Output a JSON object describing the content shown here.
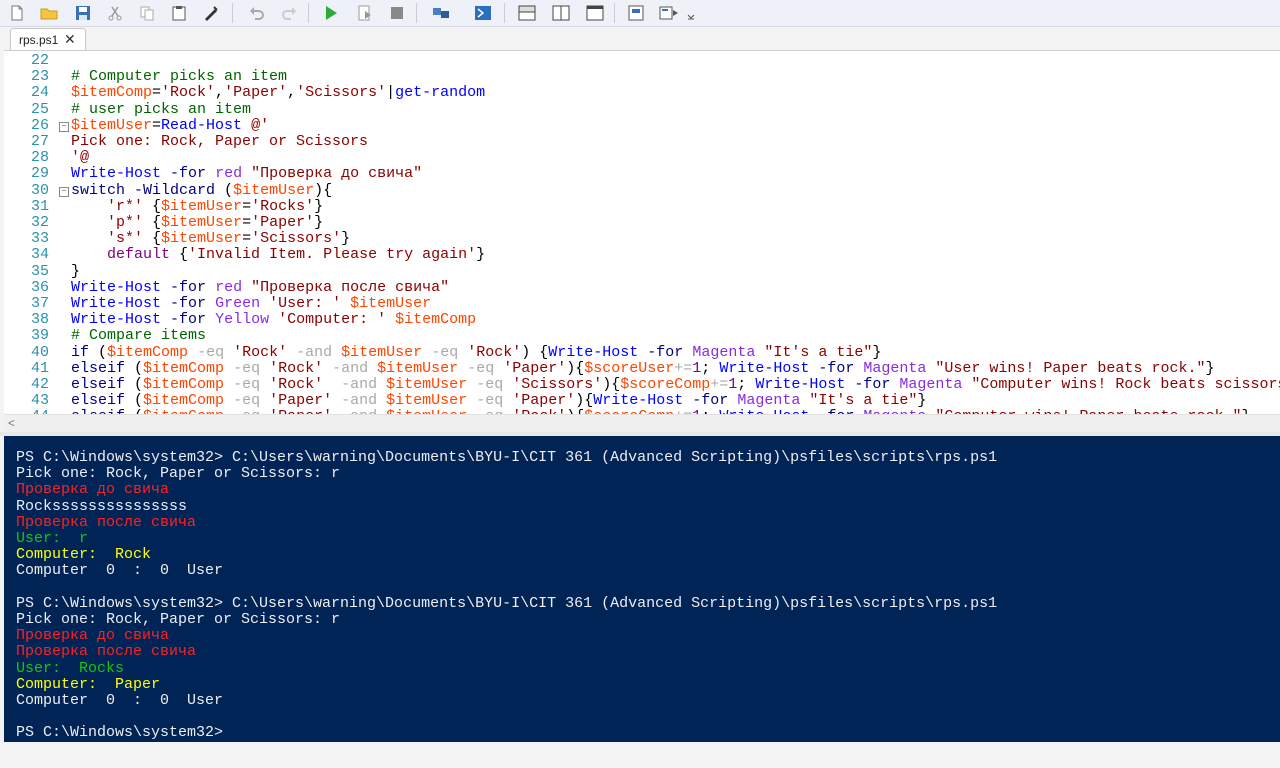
{
  "toolbar": {
    "icons": [
      "new-file-icon",
      "open-folder-icon",
      "save-icon",
      "cut-icon",
      "copy-icon",
      "paste-icon",
      "clear-icon",
      "undo-icon",
      "redo-icon",
      "run-icon",
      "run-selection-icon",
      "stop-icon",
      "remote-icon",
      "powershell-icon",
      "layout-top-icon",
      "layout-right-icon",
      "layout-max-icon",
      "show-script-pane-icon",
      "show-commands-icon",
      "overflow-icon"
    ]
  },
  "tab": {
    "label": "rps.ps1",
    "close": "✕"
  },
  "editor": {
    "lines": [
      {
        "n": "22",
        "fold": false,
        "tokens": []
      },
      {
        "n": "23",
        "fold": false,
        "tokens": [
          [
            "t-comment",
            "# Computer picks an item"
          ]
        ]
      },
      {
        "n": "24",
        "fold": false,
        "tokens": [
          [
            "t-var",
            "$itemComp"
          ],
          [
            "t-plain",
            "="
          ],
          [
            "t-str",
            "'Rock'"
          ],
          [
            "t-plain",
            ","
          ],
          [
            "t-str",
            "'Paper'"
          ],
          [
            "t-plain",
            ","
          ],
          [
            "t-str",
            "'Scissors'"
          ],
          [
            "t-plain",
            "|"
          ],
          [
            "t-cmd",
            "get-random"
          ]
        ]
      },
      {
        "n": "25",
        "fold": false,
        "tokens": [
          [
            "t-comment",
            "# user picks an item"
          ]
        ]
      },
      {
        "n": "26",
        "fold": true,
        "tokens": [
          [
            "t-var",
            "$itemUser"
          ],
          [
            "t-plain",
            "="
          ],
          [
            "t-cmd",
            "Read-Host"
          ],
          [
            "t-plain",
            " "
          ],
          [
            "t-str",
            "@'"
          ]
        ]
      },
      {
        "n": "27",
        "fold": false,
        "tokens": [
          [
            "t-str",
            "Pick one: Rock, Paper or Scissors"
          ]
        ]
      },
      {
        "n": "28",
        "fold": false,
        "tokens": [
          [
            "t-str",
            "'@"
          ]
        ]
      },
      {
        "n": "29",
        "fold": false,
        "tokens": [
          [
            "t-cmd",
            "Write-Host"
          ],
          [
            "t-plain",
            " "
          ],
          [
            "t-param",
            "-for"
          ],
          [
            "t-plain",
            " "
          ],
          [
            "t-attr",
            "red"
          ],
          [
            "t-plain",
            " "
          ],
          [
            "t-str",
            "\"Проверка до свича\""
          ]
        ]
      },
      {
        "n": "30",
        "fold": true,
        "tokens": [
          [
            "t-kw",
            "switch"
          ],
          [
            "t-plain",
            " "
          ],
          [
            "t-param",
            "-Wildcard"
          ],
          [
            "t-plain",
            " ("
          ],
          [
            "t-var",
            "$itemUser"
          ],
          [
            "t-plain",
            "){"
          ]
        ]
      },
      {
        "n": "31",
        "fold": false,
        "tokens": [
          [
            "t-plain",
            "    "
          ],
          [
            "t-str",
            "'r*'"
          ],
          [
            "t-plain",
            " {"
          ],
          [
            "t-var",
            "$itemUser"
          ],
          [
            "t-plain",
            "="
          ],
          [
            "t-str",
            "'Rocks'"
          ],
          [
            "t-plain",
            "}"
          ]
        ]
      },
      {
        "n": "32",
        "fold": false,
        "tokens": [
          [
            "t-plain",
            "    "
          ],
          [
            "t-str",
            "'p*'"
          ],
          [
            "t-plain",
            " {"
          ],
          [
            "t-var",
            "$itemUser"
          ],
          [
            "t-plain",
            "="
          ],
          [
            "t-str",
            "'Paper'"
          ],
          [
            "t-plain",
            "}"
          ]
        ]
      },
      {
        "n": "33",
        "fold": false,
        "tokens": [
          [
            "t-plain",
            "    "
          ],
          [
            "t-str",
            "'s*'"
          ],
          [
            "t-plain",
            " {"
          ],
          [
            "t-var",
            "$itemUser"
          ],
          [
            "t-plain",
            "="
          ],
          [
            "t-str",
            "'Scissors'"
          ],
          [
            "t-plain",
            "}"
          ]
        ]
      },
      {
        "n": "34",
        "fold": false,
        "tokens": [
          [
            "t-plain",
            "    "
          ],
          [
            "t-num",
            "default"
          ],
          [
            "t-plain",
            " {"
          ],
          [
            "t-str",
            "'Invalid Item. Please try again'"
          ],
          [
            "t-plain",
            "}"
          ]
        ]
      },
      {
        "n": "35",
        "fold": false,
        "tokens": [
          [
            "t-plain",
            "}"
          ]
        ]
      },
      {
        "n": "36",
        "fold": false,
        "tokens": [
          [
            "t-cmd",
            "Write-Host"
          ],
          [
            "t-plain",
            " "
          ],
          [
            "t-param",
            "-for"
          ],
          [
            "t-plain",
            " "
          ],
          [
            "t-attr",
            "red"
          ],
          [
            "t-plain",
            " "
          ],
          [
            "t-str",
            "\"Проверка после свича\""
          ]
        ]
      },
      {
        "n": "37",
        "fold": false,
        "tokens": [
          [
            "t-cmd",
            "Write-Host"
          ],
          [
            "t-plain",
            " "
          ],
          [
            "t-param",
            "-for"
          ],
          [
            "t-plain",
            " "
          ],
          [
            "t-attr",
            "Green"
          ],
          [
            "t-plain",
            " "
          ],
          [
            "t-str",
            "'User: '"
          ],
          [
            "t-plain",
            " "
          ],
          [
            "t-var",
            "$itemUser"
          ]
        ]
      },
      {
        "n": "38",
        "fold": false,
        "tokens": [
          [
            "t-cmd",
            "Write-Host"
          ],
          [
            "t-plain",
            " "
          ],
          [
            "t-param",
            "-for"
          ],
          [
            "t-plain",
            " "
          ],
          [
            "t-attr",
            "Yellow"
          ],
          [
            "t-plain",
            " "
          ],
          [
            "t-str",
            "'Computer: '"
          ],
          [
            "t-plain",
            " "
          ],
          [
            "t-var",
            "$itemComp"
          ]
        ]
      },
      {
        "n": "39",
        "fold": false,
        "tokens": [
          [
            "t-comment",
            "# Compare items"
          ]
        ]
      },
      {
        "n": "40",
        "fold": false,
        "tokens": [
          [
            "t-kw",
            "if"
          ],
          [
            "t-plain",
            " ("
          ],
          [
            "t-var",
            "$itemComp"
          ],
          [
            "t-plain",
            " "
          ],
          [
            "t-op",
            "-eq"
          ],
          [
            "t-plain",
            " "
          ],
          [
            "t-str",
            "'Rock'"
          ],
          [
            "t-plain",
            " "
          ],
          [
            "t-op",
            "-and"
          ],
          [
            "t-plain",
            " "
          ],
          [
            "t-var",
            "$itemUser"
          ],
          [
            "t-plain",
            " "
          ],
          [
            "t-op",
            "-eq"
          ],
          [
            "t-plain",
            " "
          ],
          [
            "t-str",
            "'Rock'"
          ],
          [
            "t-plain",
            ") {"
          ],
          [
            "t-cmd",
            "Write-Host"
          ],
          [
            "t-plain",
            " "
          ],
          [
            "t-param",
            "-for"
          ],
          [
            "t-plain",
            " "
          ],
          [
            "t-attr",
            "Magenta"
          ],
          [
            "t-plain",
            " "
          ],
          [
            "t-str",
            "\"It's a tie\""
          ],
          [
            "t-plain",
            "}"
          ]
        ]
      },
      {
        "n": "41",
        "fold": false,
        "tokens": [
          [
            "t-kw",
            "elseif"
          ],
          [
            "t-plain",
            " ("
          ],
          [
            "t-var",
            "$itemComp"
          ],
          [
            "t-plain",
            " "
          ],
          [
            "t-op",
            "-eq"
          ],
          [
            "t-plain",
            " "
          ],
          [
            "t-str",
            "'Rock'"
          ],
          [
            "t-plain",
            " "
          ],
          [
            "t-op",
            "-and"
          ],
          [
            "t-plain",
            " "
          ],
          [
            "t-var",
            "$itemUser"
          ],
          [
            "t-plain",
            " "
          ],
          [
            "t-op",
            "-eq"
          ],
          [
            "t-plain",
            " "
          ],
          [
            "t-str",
            "'Paper'"
          ],
          [
            "t-plain",
            "){"
          ],
          [
            "t-var",
            "$scoreUser"
          ],
          [
            "t-op",
            "+="
          ],
          [
            "t-num",
            "1"
          ],
          [
            "t-plain",
            "; "
          ],
          [
            "t-cmd",
            "Write-Host"
          ],
          [
            "t-plain",
            " "
          ],
          [
            "t-param",
            "-for"
          ],
          [
            "t-plain",
            " "
          ],
          [
            "t-attr",
            "Magenta"
          ],
          [
            "t-plain",
            " "
          ],
          [
            "t-str",
            "\"User wins! Paper beats rock.\""
          ],
          [
            "t-plain",
            "}"
          ]
        ]
      },
      {
        "n": "42",
        "fold": false,
        "tokens": [
          [
            "t-kw",
            "elseif"
          ],
          [
            "t-plain",
            " ("
          ],
          [
            "t-var",
            "$itemComp"
          ],
          [
            "t-plain",
            " "
          ],
          [
            "t-op",
            "-eq"
          ],
          [
            "t-plain",
            " "
          ],
          [
            "t-str",
            "'Rock'"
          ],
          [
            "t-plain",
            "  "
          ],
          [
            "t-op",
            "-and"
          ],
          [
            "t-plain",
            " "
          ],
          [
            "t-var",
            "$itemUser"
          ],
          [
            "t-plain",
            " "
          ],
          [
            "t-op",
            "-eq"
          ],
          [
            "t-plain",
            " "
          ],
          [
            "t-str",
            "'Scissors'"
          ],
          [
            "t-plain",
            "){"
          ],
          [
            "t-var",
            "$scoreComp"
          ],
          [
            "t-op",
            "+="
          ],
          [
            "t-num",
            "1"
          ],
          [
            "t-plain",
            "; "
          ],
          [
            "t-cmd",
            "Write-Host"
          ],
          [
            "t-plain",
            " "
          ],
          [
            "t-param",
            "-for"
          ],
          [
            "t-plain",
            " "
          ],
          [
            "t-attr",
            "Magenta"
          ],
          [
            "t-plain",
            " "
          ],
          [
            "t-str",
            "\"Computer wins! Rock beats scissors.\""
          ],
          [
            "t-plain",
            "}"
          ]
        ]
      },
      {
        "n": "43",
        "fold": false,
        "tokens": [
          [
            "t-kw",
            "elseif"
          ],
          [
            "t-plain",
            " ("
          ],
          [
            "t-var",
            "$itemComp"
          ],
          [
            "t-plain",
            " "
          ],
          [
            "t-op",
            "-eq"
          ],
          [
            "t-plain",
            " "
          ],
          [
            "t-str",
            "'Paper'"
          ],
          [
            "t-plain",
            " "
          ],
          [
            "t-op",
            "-and"
          ],
          [
            "t-plain",
            " "
          ],
          [
            "t-var",
            "$itemUser"
          ],
          [
            "t-plain",
            " "
          ],
          [
            "t-op",
            "-eq"
          ],
          [
            "t-plain",
            " "
          ],
          [
            "t-str",
            "'Paper'"
          ],
          [
            "t-plain",
            "){"
          ],
          [
            "t-cmd",
            "Write-Host"
          ],
          [
            "t-plain",
            " "
          ],
          [
            "t-param",
            "-for"
          ],
          [
            "t-plain",
            " "
          ],
          [
            "t-attr",
            "Magenta"
          ],
          [
            "t-plain",
            " "
          ],
          [
            "t-str",
            "\"It's a tie\""
          ],
          [
            "t-plain",
            "}"
          ]
        ]
      },
      {
        "n": "44",
        "fold": false,
        "tokens": [
          [
            "t-kw",
            "elseif"
          ],
          [
            "t-plain",
            " ("
          ],
          [
            "t-var",
            "$itemComp"
          ],
          [
            "t-plain",
            " "
          ],
          [
            "t-op",
            "-eq"
          ],
          [
            "t-plain",
            " "
          ],
          [
            "t-str",
            "'Paper'"
          ],
          [
            "t-plain",
            " "
          ],
          [
            "t-op",
            "-and"
          ],
          [
            "t-plain",
            " "
          ],
          [
            "t-var",
            "$itemUser"
          ],
          [
            "t-plain",
            " "
          ],
          [
            "t-op",
            "-eq"
          ],
          [
            "t-plain",
            " "
          ],
          [
            "t-str",
            "'Rock'"
          ],
          [
            "t-plain",
            "){"
          ],
          [
            "t-var",
            "$scoreComp"
          ],
          [
            "t-op",
            "+="
          ],
          [
            "t-num",
            "1"
          ],
          [
            "t-plain",
            "; "
          ],
          [
            "t-cmd",
            "Write-Host"
          ],
          [
            "t-plain",
            " "
          ],
          [
            "t-param",
            "-for"
          ],
          [
            "t-plain",
            " "
          ],
          [
            "t-attr",
            "Magenta"
          ],
          [
            "t-plain",
            " "
          ],
          [
            "t-str",
            "\"Computer wins! Paper beats rock.\""
          ],
          [
            "t-plain",
            "}"
          ]
        ]
      }
    ]
  },
  "console": {
    "lines": [
      {
        "cls": "",
        "text": "PS C:\\Windows\\system32> C:\\Users\\warning\\Documents\\BYU-I\\CIT 361 (Advanced Scripting)\\psfiles\\scripts\\rps.ps1"
      },
      {
        "cls": "",
        "text": "Pick one: Rock, Paper or Scissors: r"
      },
      {
        "cls": "c-red",
        "text": "Проверка до свича"
      },
      {
        "cls": "",
        "text": "Rocksssssssssssssss"
      },
      {
        "cls": "c-red",
        "text": "Проверка после свича"
      },
      {
        "cls": "c-green",
        "text": "User:  r"
      },
      {
        "cls": "c-yellow2",
        "text": "Computer:  Rock"
      },
      {
        "cls": "",
        "text": "Computer  0  :  0  User"
      },
      {
        "cls": "",
        "text": ""
      },
      {
        "cls": "",
        "text": "PS C:\\Windows\\system32> C:\\Users\\warning\\Documents\\BYU-I\\CIT 361 (Advanced Scripting)\\psfiles\\scripts\\rps.ps1"
      },
      {
        "cls": "",
        "text": "Pick one: Rock, Paper or Scissors: r"
      },
      {
        "cls": "c-red",
        "text": "Проверка до свича"
      },
      {
        "cls": "c-red",
        "text": "Проверка после свича"
      },
      {
        "cls": "c-green",
        "text": "User:  Rocks"
      },
      {
        "cls": "c-yellow2",
        "text": "Computer:  Paper"
      },
      {
        "cls": "",
        "text": "Computer  0  :  0  User"
      },
      {
        "cls": "",
        "text": ""
      },
      {
        "cls": "",
        "text": "PS C:\\Windows\\system32>"
      }
    ]
  }
}
